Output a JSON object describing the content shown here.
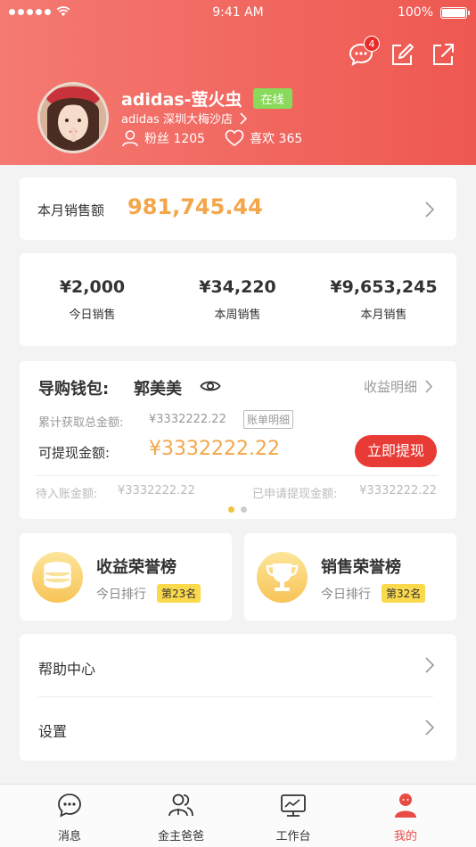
{
  "status_bar": {
    "time": "9:41 AM",
    "battery": "100%"
  },
  "header": {
    "message_badge": "4"
  },
  "profile": {
    "name": "adidas-萤火虫",
    "status": "在线",
    "store": "adidas 深圳大梅沙店",
    "fans_label": "粉丝 1205",
    "likes_label": "喜欢 365"
  },
  "monthly_sales": {
    "label": "本月销售额",
    "value": "981,745.44"
  },
  "sales_summary": [
    {
      "amount": "¥2,000",
      "label": "今日销售"
    },
    {
      "amount": "¥34,220",
      "label": "本周销售"
    },
    {
      "amount": "¥9,653,245",
      "label": "本月销售"
    }
  ],
  "wallet": {
    "title": "导购钱包:",
    "owner": "郭美美",
    "detail_link": "收益明细",
    "total_label": "累计获取总金额:",
    "total_value": "¥3332222.22",
    "bill_tag": "账单明细",
    "withdraw_label": "可提现金额:",
    "withdraw_value": "¥3332222.22",
    "withdraw_button": "立即提现",
    "pending_label": "待入账金额:",
    "pending_value": "¥3332222.22",
    "applied_label": "已申请提现金额:",
    "applied_value": "¥3332222.22"
  },
  "honor": [
    {
      "title": "收益荣誉榜",
      "sub": "今日排行",
      "rank": "第23名",
      "icon": "coins-icon"
    },
    {
      "title": "销售荣誉榜",
      "sub": "今日排行",
      "rank": "第32名",
      "icon": "trophy-icon"
    }
  ],
  "menu": [
    {
      "label": "帮助中心"
    },
    {
      "label": "设置"
    }
  ],
  "tabs": [
    {
      "label": "消息",
      "icon": "chat-icon"
    },
    {
      "label": "金主爸爸",
      "icon": "users-icon"
    },
    {
      "label": "工作台",
      "icon": "monitor-icon"
    },
    {
      "label": "我的",
      "icon": "person-icon",
      "active": true
    }
  ],
  "colors": {
    "accent": "#ee5851",
    "amount": "#f4a64b",
    "online": "#89d95a",
    "rank": "#fbd94c"
  }
}
